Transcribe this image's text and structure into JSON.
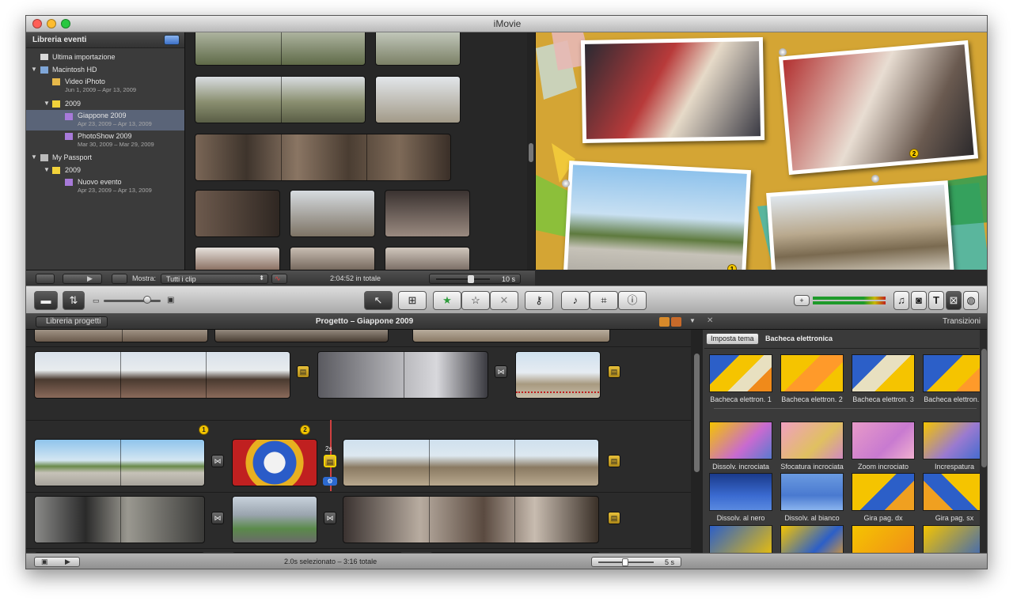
{
  "window": {
    "title": "iMovie"
  },
  "event_library": {
    "header": "Libreria eventi",
    "items": [
      {
        "label": "Ultima importazione",
        "sub": ""
      },
      {
        "label": "Macintosh HD",
        "sub": ""
      },
      {
        "label": "Video iPhoto",
        "sub": "Jun 1, 2009 – Apr 13, 2009"
      },
      {
        "label": "2009",
        "sub": ""
      },
      {
        "label": "Giappone 2009",
        "sub": "Apr 23, 2009 – Apr 13, 2009"
      },
      {
        "label": "PhotoShow 2009",
        "sub": "Mar 30, 2009 – Mar 29, 2009"
      },
      {
        "label": "My Passport",
        "sub": ""
      },
      {
        "label": "2009",
        "sub": ""
      },
      {
        "label": "Nuovo evento",
        "sub": "Apr 23, 2009 – Apr 13, 2009"
      }
    ]
  },
  "event_bar": {
    "show_label": "Mostra:",
    "show_value": "Tutti i clip",
    "total": "2:04:52 in totale",
    "duration": "10 s"
  },
  "viewer": {
    "badges": [
      "2",
      "1"
    ]
  },
  "project": {
    "back_label": "Libreria progetti",
    "title": "Progetto – Giappone 2009",
    "badges": [
      "1",
      "2"
    ],
    "playhead_label": "2s"
  },
  "transitions": {
    "panel_title": "Transizioni",
    "theme_button": "Imposta tema",
    "theme_name": "Bacheca elettronica",
    "items": [
      "Bacheca elettron. 1",
      "Bacheca elettron. 2",
      "Bacheca elettron. 3",
      "Bacheca elettron. 4",
      "Dissolv. incrociata",
      "Sfocatura incrociata",
      "Zoom incrociato",
      "Increspatura",
      "Dissolv. al nero",
      "Dissolv. al bianco",
      "Gira pag. dx",
      "Gira pag. sx"
    ]
  },
  "bottom_bar": {
    "status": "2.0s selezionato – 3:16 totale",
    "duration": "5 s"
  },
  "colors": {
    "accent": "#3b6fc7",
    "cork": "#d4a534",
    "badge": "#f2c400"
  }
}
